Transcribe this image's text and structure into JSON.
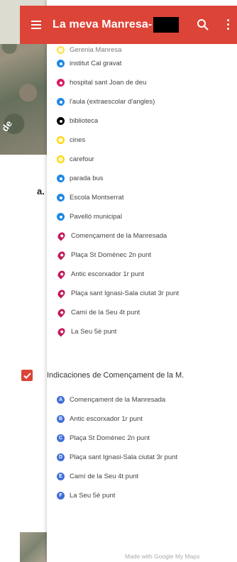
{
  "header": {
    "title": "La meva Manresa-"
  },
  "background": {
    "map_label": "de",
    "side_char": "a."
  },
  "layer_items": [
    {
      "label": "Gerenia Manresa",
      "icon": "info-icon",
      "color": "#ffd400",
      "shape": "ring",
      "partial": true
    },
    {
      "label": "institut Cal gravat",
      "icon": "school-icon",
      "color": "#1e88e5",
      "shape": "dot"
    },
    {
      "label": "hospital sant Joan de deu",
      "icon": "hospital-icon",
      "color": "#d81b60",
      "shape": "dot"
    },
    {
      "label": "l'aula (extraescolar d'angles)",
      "icon": "school-icon",
      "color": "#1e88e5",
      "shape": "dot"
    },
    {
      "label": "biblioteca",
      "icon": "library-icon",
      "color": "#000000",
      "shape": "dot"
    },
    {
      "label": "cines",
      "icon": "circle-icon",
      "color": "#ffd400",
      "shape": "ring"
    },
    {
      "label": "carefour",
      "icon": "circle-icon",
      "color": "#ffd400",
      "shape": "ring"
    },
    {
      "label": "parada bus",
      "icon": "bus-icon",
      "color": "#1e88e5",
      "shape": "dot"
    },
    {
      "label": "Escola Montserrat",
      "icon": "school-icon",
      "color": "#1e88e5",
      "shape": "dot"
    },
    {
      "label": "Pavelló municipal",
      "icon": "sports-icon",
      "color": "#1e88e5",
      "shape": "dot"
    },
    {
      "label": "Començament de la Manresada",
      "icon": "pin-icon",
      "color": "#c2185b",
      "shape": "pin"
    },
    {
      "label": "Plaça St Domènec 2n punt",
      "icon": "pin-icon",
      "color": "#c2185b",
      "shape": "pin"
    },
    {
      "label": "Antic escorxador 1r punt",
      "icon": "pin-icon",
      "color": "#c2185b",
      "shape": "pin"
    },
    {
      "label": "Plaça sant Ignasi-Sala ciutat 3r punt",
      "icon": "pin-icon",
      "color": "#c2185b",
      "shape": "pin"
    },
    {
      "label": "Camí de la Seu  4t punt",
      "icon": "pin-icon",
      "color": "#c2185b",
      "shape": "pin"
    },
    {
      "label": "La Seu 5è punt",
      "icon": "pin-icon",
      "color": "#c2185b",
      "shape": "pin"
    }
  ],
  "directions": {
    "title": "Indicaciones de Començament de la M.",
    "checked": true,
    "items": [
      {
        "letter": "A",
        "label": "Començament de la Manresada"
      },
      {
        "letter": "B",
        "label": "Antic escorxador 1r punt"
      },
      {
        "letter": "C",
        "label": "Plaça St Domènec 2n punt"
      },
      {
        "letter": "D",
        "label": "Plaça sant Ignasi-Sala ciutat 3r punt"
      },
      {
        "letter": "E",
        "label": "Camí de la Seu  4t punt"
      },
      {
        "letter": "F",
        "label": "La Seu 5è punt"
      }
    ]
  },
  "footer": {
    "text": "Made with Google My Maps"
  },
  "colors": {
    "header": "#dc4437",
    "direction_marker": "#3f6fd8"
  }
}
